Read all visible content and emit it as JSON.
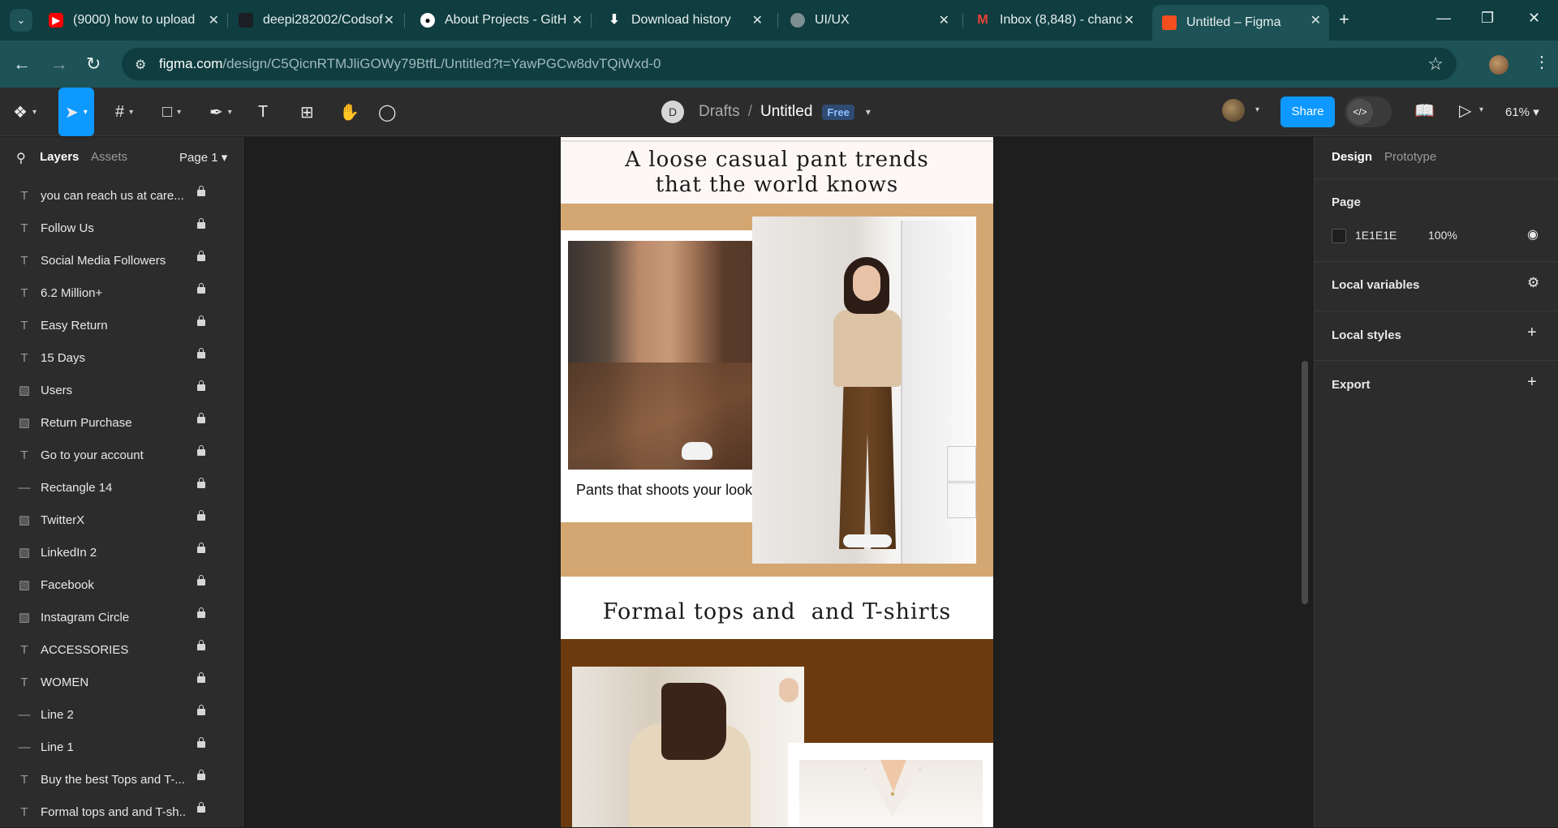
{
  "browser": {
    "tabs": [
      {
        "label": "(9000) how to upload",
        "favicon": "youtube-icon",
        "favicon_color": "#ff0000"
      },
      {
        "label": "deepi282002/Codsof",
        "favicon": "github-icon",
        "favicon_color": "#1b1f23"
      },
      {
        "label": "About Projects - GitH",
        "favicon": "github-icon",
        "favicon_color": "#1b1f23"
      },
      {
        "label": "Download history",
        "favicon": "download-icon",
        "favicon_color": "#0f3d40"
      },
      {
        "label": "UI/UX",
        "favicon": "globe-icon",
        "favicon_color": "#7d8f90"
      },
      {
        "label": "Inbox (8,848) - chand",
        "favicon": "gmail-icon",
        "favicon_color": "#ea4335"
      },
      {
        "label": "Untitled – Figma",
        "favicon": "figma-icon",
        "favicon_color": "#f24e1e"
      }
    ],
    "address": {
      "domain": "figma.com",
      "path": "/design/C5QicnRTMJliGOWy79BtfL/Untitled?t=YawPGCw8dvTQiWxd-0"
    }
  },
  "figma": {
    "breadcrumb": {
      "avatar_letter": "D",
      "folder": "Drafts",
      "separator": "/",
      "file": "Untitled",
      "badge": "Free"
    },
    "share_label": "Share",
    "devmode_icon": "</>",
    "zoom": "61%",
    "left_panel": {
      "tab_layers": "Layers",
      "tab_assets": "Assets",
      "page": "Page 1",
      "layers": [
        {
          "type": "T",
          "name": "you can reach us at care..."
        },
        {
          "type": "T",
          "name": "Follow Us"
        },
        {
          "type": "T",
          "name": "Social Media Followers"
        },
        {
          "type": "T",
          "name": "6.2 Million+"
        },
        {
          "type": "T",
          "name": "Easy Return"
        },
        {
          "type": "T",
          "name": "15 Days"
        },
        {
          "type": "▧",
          "name": "Users"
        },
        {
          "type": "▧",
          "name": "Return Purchase"
        },
        {
          "type": "T",
          "name": "Go to your account"
        },
        {
          "type": "—",
          "name": "Rectangle 14"
        },
        {
          "type": "▧",
          "name": "TwitterX"
        },
        {
          "type": "▧",
          "name": "LinkedIn 2"
        },
        {
          "type": "▧",
          "name": "Facebook"
        },
        {
          "type": "▧",
          "name": "Instagram Circle"
        },
        {
          "type": "T",
          "name": "ACCESSORIES"
        },
        {
          "type": "T",
          "name": "WOMEN"
        },
        {
          "type": "—",
          "name": "Line 2"
        },
        {
          "type": "—",
          "name": "Line 1"
        },
        {
          "type": "T",
          "name": "Buy the best Tops and T-..."
        },
        {
          "type": "T",
          "name": "Formal tops and and T-sh..."
        }
      ]
    },
    "canvas": {
      "heading1": "A loose casual pant trends\nthat the world knows",
      "caption1": "Pants that shoots your looks",
      "heading2": "Formal tops and  and T-shirts"
    },
    "right_panel": {
      "tab_design": "Design",
      "tab_prototype": "Prototype",
      "page_title": "Page",
      "page_color": "1E1E1E",
      "page_opacity": "100%",
      "local_variables": "Local variables",
      "local_styles": "Local styles",
      "export": "Export"
    },
    "help_label": "?"
  }
}
